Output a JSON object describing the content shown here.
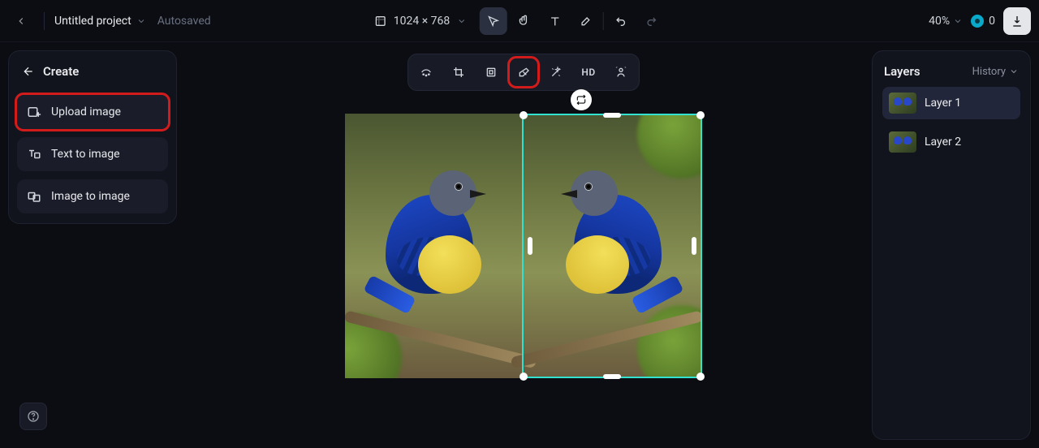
{
  "topbar": {
    "project_name": "Untitled project",
    "autosave": "Autosaved",
    "canvas_dimensions": "1024 × 768",
    "zoom": "40%",
    "credits": "0"
  },
  "left_panel": {
    "title": "Create",
    "options": {
      "upload": "Upload image",
      "text_to_image": "Text to image",
      "image_to_image": "Image to image"
    }
  },
  "canvas_toolbar": {
    "hd_label": "HD"
  },
  "right_panel": {
    "layers_tab": "Layers",
    "history_tab": "History",
    "layers": [
      {
        "label": "Layer 1"
      },
      {
        "label": "Layer 2"
      }
    ]
  }
}
